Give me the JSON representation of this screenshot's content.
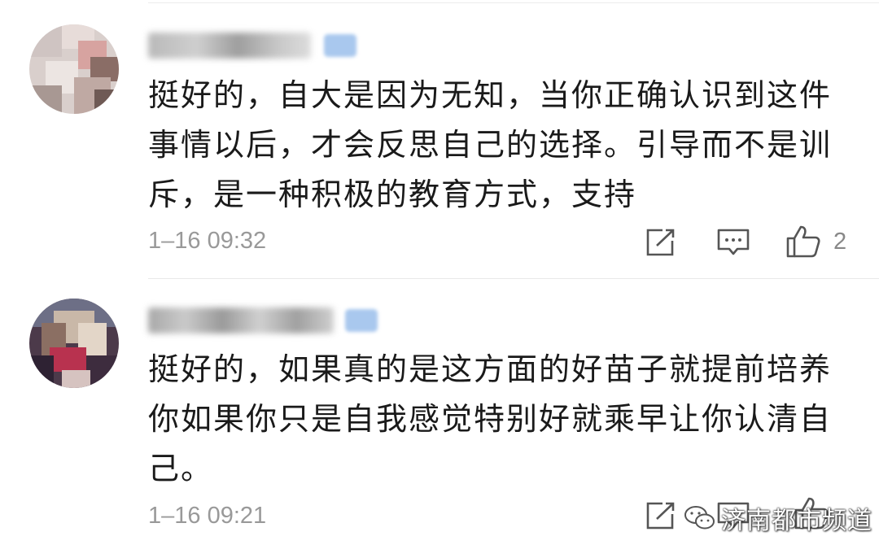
{
  "comments": [
    {
      "text": "挺好的，自大是因为无知，当你正确认识到这件事情以后，才会反思自己的选择。引导而不是训斥，是一种积极的教育方式，支持",
      "time": "1–16 09:32",
      "likes": "2"
    },
    {
      "text": "挺好的，如果真的是这方面的好苗子就提前培养你如果你只是自我感觉特别好就乘早让你认清自己。",
      "time": "1–16 09:21",
      "likes": ""
    }
  ],
  "watermark": {
    "text": "济南都市频道"
  },
  "icons": {
    "share": "share-icon",
    "reply": "comment-icon",
    "like": "thumbs-up-icon",
    "watermark": "wechat-icon"
  },
  "colors": {
    "text": "#1a1a1a",
    "meta": "#999999",
    "badge": "#a9c8ee"
  }
}
